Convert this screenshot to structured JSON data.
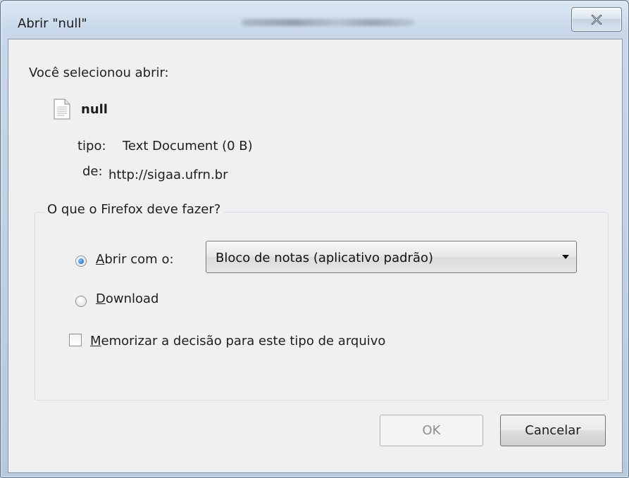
{
  "window": {
    "title": "Abrir \"null\""
  },
  "dialog": {
    "heading": "Você selecionou abrir:",
    "file_name": "null",
    "type_label": "tipo:",
    "type_value": "Text Document (0 B)",
    "from_label": "de:",
    "from_value": "http://sigaa.ufrn.br"
  },
  "action_group": {
    "legend": "O que o Firefox deve fazer?",
    "open_with": {
      "mnemonic": "A",
      "rest": "brir com o:",
      "checked": true
    },
    "app_select": {
      "selected": "Bloco de notas (aplicativo padrão)"
    },
    "download": {
      "mnemonic": "D",
      "rest": "ownload",
      "checked": false
    },
    "remember": {
      "mnemonic": "M",
      "rest": "emorizar a decisão para este tipo de arquivo",
      "checked": false
    }
  },
  "buttons": {
    "ok_label": "OK",
    "cancel_label": "Cancelar"
  }
}
